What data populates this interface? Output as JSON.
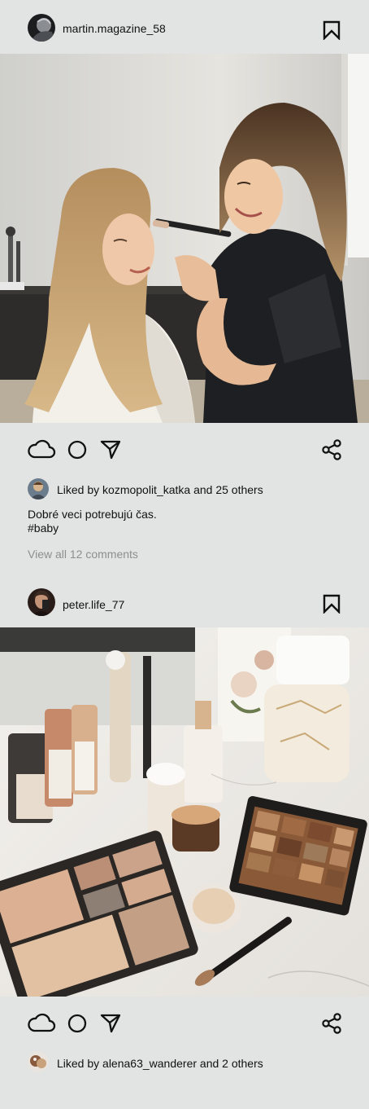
{
  "posts": [
    {
      "username": "martin.magazine_58",
      "avatar_icon": "profile-photo-dark",
      "image_alt": "Makeup artist applying eye makeup to a smiling bride in a bright room",
      "likes_text": "Liked by kozmopolit_katka and 25 others",
      "caption_line1": "Dobré veci potrebujú čas.",
      "caption_line2": "#baby",
      "comments_link": "View all 12 comments"
    },
    {
      "username": "peter.life_77",
      "avatar_icon": "profile-photo-selfie",
      "image_alt": "Cosmetics flat lay with palettes, foundation bottles, brushes and powder on a marble desk",
      "likes_text": "Liked by alena63_wanderer and 2 others"
    }
  ],
  "icons": {
    "like": "cloud-like-icon",
    "comment": "circle-comment-icon",
    "share": "paper-plane-icon",
    "save": "bookmark-icon",
    "network_share": "share-nodes-icon"
  },
  "colors": {
    "background": "#e2e4e3",
    "text": "#111111",
    "muted_text": "#8c8f8f"
  }
}
